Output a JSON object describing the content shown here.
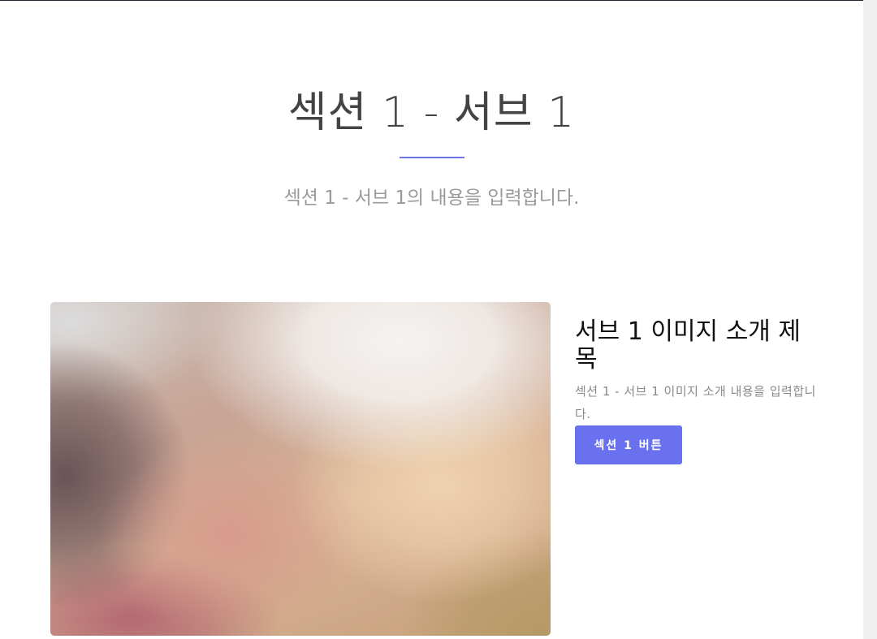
{
  "section": {
    "title": "섹션 1 - 서브 1",
    "description": "섹션 1 - 서브 1의 내용을 입력합니다."
  },
  "intro": {
    "title": "서브 1 이미지 소개 제목",
    "text": "섹션 1 - 서브 1 이미지 소개 내용을 입력합니다.",
    "button_label": "섹션 1 버튼"
  },
  "colors": {
    "accent": "#6a71ef",
    "underline": "#6b74e8",
    "title_text": "#444444",
    "muted_text": "#9a9a9a"
  }
}
